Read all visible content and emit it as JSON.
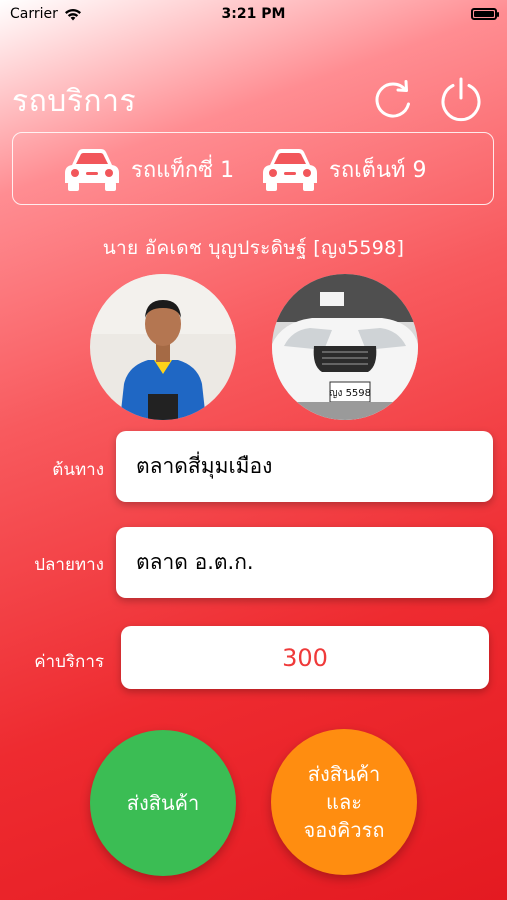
{
  "status_bar": {
    "carrier": "Carrier",
    "time": "3:21 PM"
  },
  "header": {
    "title": "รถบริการ",
    "refresh_icon": "refresh-icon",
    "power_icon": "power-icon"
  },
  "counts": {
    "taxi_label": "รถแท็กซี่ 1",
    "tent_label": "รถเต็นท์ 9"
  },
  "driver": {
    "name": "นาย อัคเดช บุญประดิษฐ์ [ญง5598]"
  },
  "form": {
    "origin_label": "ต้นทาง",
    "origin_value": "ตลาดสี่มุมเมือง",
    "destination_label": "ปลายทาง",
    "destination_value": "ตลาด อ.ต.ก.",
    "price_label": "ค่าบริการ",
    "price_value": "300"
  },
  "actions": {
    "send_goods": "ส่งสินค้า",
    "send_and_book": "ส่งสินค้า\nและ\nจองคิวรถ"
  },
  "car_photo": {
    "plate_text": "ญง 5598"
  },
  "colors": {
    "send_button": "#3bbd54",
    "book_button": "#ff8d10",
    "price_text": "#ef3a3a"
  }
}
